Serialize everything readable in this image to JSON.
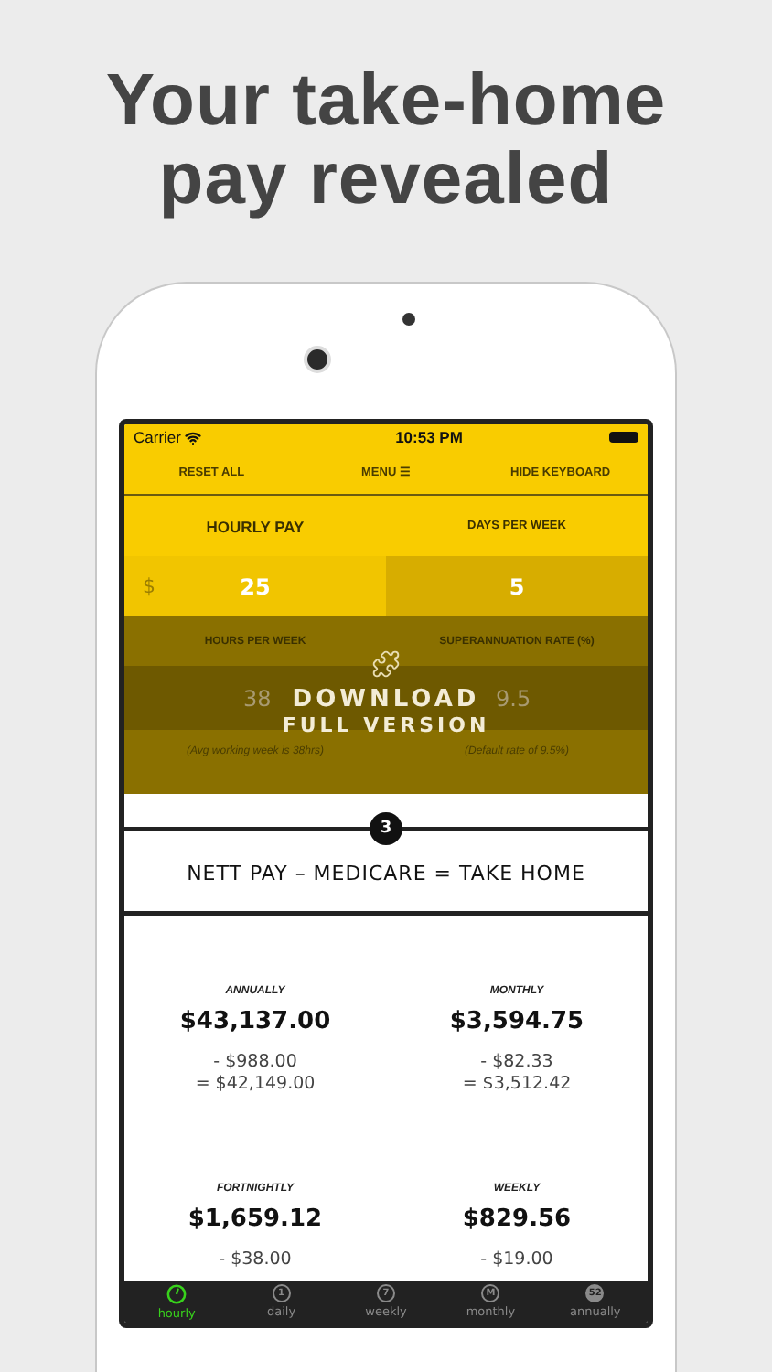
{
  "headline": [
    "Your take-home",
    "pay revealed"
  ],
  "status_bar": {
    "carrier": "Carrier",
    "time": "10:53 PM"
  },
  "toolbar": [
    "RESET ALL",
    "MENU ☰",
    "HIDE KEYBOARD"
  ],
  "inputs_top": [
    {
      "label": "HOURLY PAY",
      "prefix": "$",
      "value": "25",
      "selected": true
    },
    {
      "label": "DAYS PER WEEK",
      "value": "5",
      "selected": false
    }
  ],
  "inputs_bottom": [
    {
      "label": "HOURS PER WEEK",
      "value": "38",
      "note": "(Avg working week is 38hrs)"
    },
    {
      "label": "SUPERANNUATION RATE (%)",
      "value": "9.5",
      "note": "(Default rate of 9.5%)"
    }
  ],
  "promo": {
    "line1": "DOWNLOAD",
    "line2": "FULL VERSION"
  },
  "step": {
    "number": "3",
    "title": "NETT PAY – MEDICARE = TAKE HOME"
  },
  "results": [
    {
      "period": "ANNUALLY",
      "nett": "$43,137.00",
      "medicare": "- $988.00",
      "take_home": "= $42,149.00"
    },
    {
      "period": "MONTHLY",
      "nett": "$3,594.75",
      "medicare": "- $82.33",
      "take_home": "= $3,512.42"
    },
    {
      "period": "FORTNIGHTLY",
      "nett": "$1,659.12",
      "medicare": "- $38.00"
    },
    {
      "period": "WEEKLY",
      "nett": "$829.56",
      "medicare": "- $19.00"
    }
  ],
  "tabs": [
    {
      "kind": "clock",
      "label": "hourly",
      "selected": true
    },
    {
      "kind": "ring",
      "badge": "1",
      "label": "daily",
      "selected": false
    },
    {
      "kind": "ring",
      "badge": "7",
      "label": "weekly",
      "selected": false
    },
    {
      "kind": "ring",
      "badge": "M",
      "label": "monthly",
      "selected": false
    },
    {
      "kind": "disc",
      "badge": "52",
      "label": "annually",
      "selected": false
    }
  ]
}
